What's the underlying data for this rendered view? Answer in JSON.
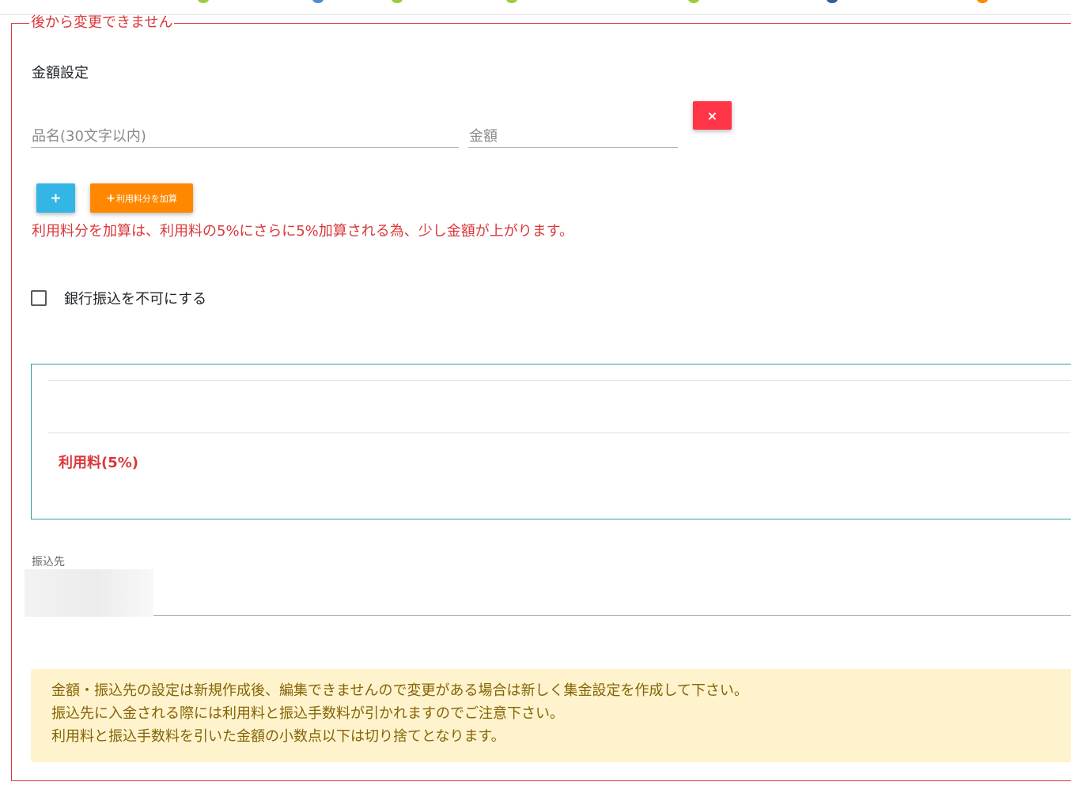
{
  "fieldset": {
    "legend": "後から変更できません"
  },
  "amount_settings": {
    "title": "金額設定",
    "item_name_placeholder": "品名(30文字以内)",
    "amount_placeholder": "金額",
    "remove_icon": "×",
    "add_icon": "+",
    "add_fee_icon": "+",
    "add_fee_label": "利用料分を加算",
    "fee_note": "利用料分を加算は、利用料の5%にさらに5%加算される為、少し金額が上がります。"
  },
  "bank_transfer": {
    "label": "銀行振込を不可にする",
    "checked": false
  },
  "summary": {
    "fee_label": "利用料(5%)"
  },
  "destination": {
    "label": "振込先"
  },
  "notice": {
    "lines": [
      "金額・振込先の設定は新規作成後、編集できませんので変更がある場合は新しく集金設定を作成して下さい。",
      "振込先に入金される際には利用料と振込手数料が引かれますのでご注意下さい。",
      "利用料と振込手数料を引いた金額の小数点以下は切り捨てとなります。"
    ]
  },
  "colors": {
    "danger": "#ff3547",
    "info": "#33b5e5",
    "warning": "#ff8800",
    "accent_red": "#d9383a",
    "teal_border": "#2aa198",
    "notice_bg": "#fff3cd",
    "notice_text": "#856404"
  }
}
